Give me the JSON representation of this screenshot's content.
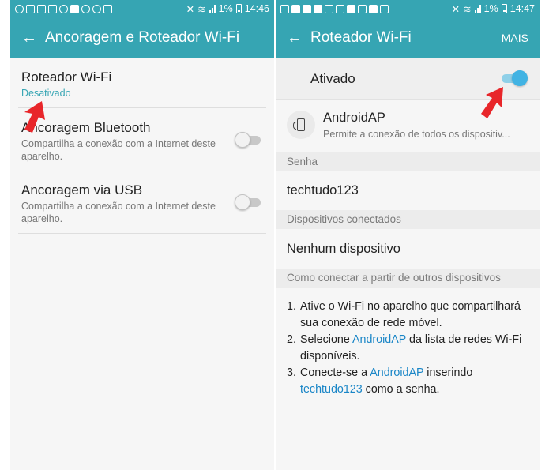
{
  "left": {
    "status": {
      "time": "14:46",
      "battery": "1%"
    },
    "header": {
      "title": "Ancoragem e Roteador Wi-Fi"
    },
    "items": [
      {
        "title": "Roteador Wi-Fi",
        "subtitle": "Desativado"
      },
      {
        "title": "Ancoragem Bluetooth",
        "subtitle": "Compartilha a conexão com a Internet deste aparelho.",
        "checked": false
      },
      {
        "title": "Ancoragem via USB",
        "subtitle": "Compartilha a conexão com a Internet deste aparelho.",
        "checked": false
      }
    ]
  },
  "right": {
    "status": {
      "time": "14:47",
      "battery": "1%"
    },
    "header": {
      "title": "Roteador Wi-Fi",
      "more": "MAIS"
    },
    "toggle": {
      "label": "Ativado",
      "checked": true
    },
    "network": {
      "name": "AndroidAP",
      "description": "Permite a conexão de todos os dispositiv..."
    },
    "password": {
      "header": "Senha",
      "value": "techtudo123"
    },
    "devices": {
      "header": "Dispositivos conectados",
      "value": "Nenhum dispositivo"
    },
    "howto": {
      "header": "Como conectar a partir de outros dispositivos",
      "steps": [
        {
          "num": "1.",
          "text": "Ative o Wi-Fi no aparelho que compartilhará sua conexão de rede móvel."
        },
        {
          "num": "2.",
          "pre": "Selecione ",
          "link": "AndroidAP",
          "post": " da lista de redes Wi-Fi disponíveis."
        },
        {
          "num": "3.",
          "pre": "Conecte-se a ",
          "link": "AndroidAP",
          "mid": " inserindo ",
          "link2": "techtudo123",
          "post": " como a senha."
        }
      ]
    }
  },
  "colors": {
    "accent": "#36a5b3",
    "switch_on": "#41b3e3",
    "link": "#1a86c7",
    "arrow": "#e8262a"
  }
}
